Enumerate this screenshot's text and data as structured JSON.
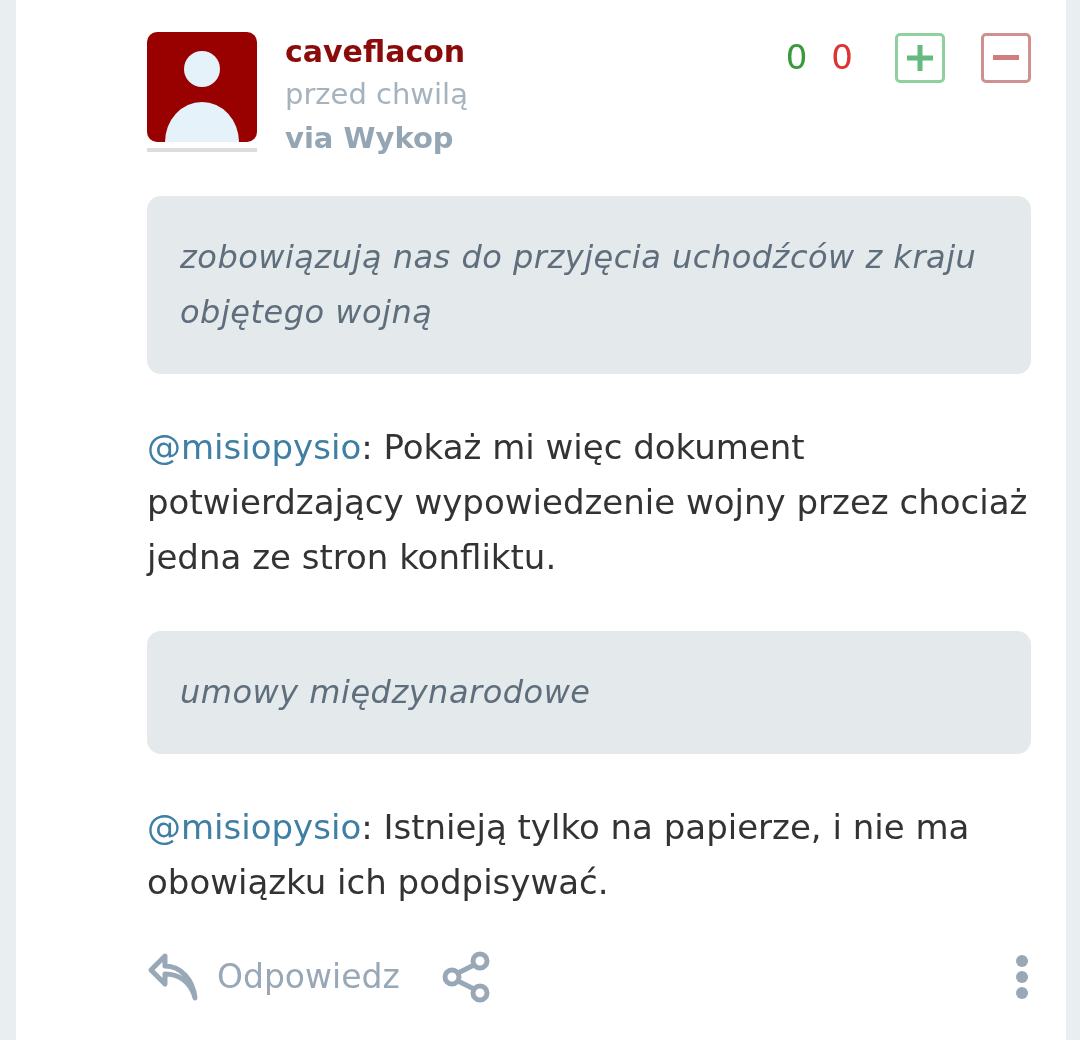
{
  "author": {
    "name": "caveflacon",
    "time": "przed chwilą",
    "source": "via Wykop"
  },
  "votes": {
    "plus_count": "0",
    "minus_count": "0"
  },
  "blocks": [
    {
      "kind": "quote",
      "text": "zobowiązują nas do przyjęcia uchodźców z kraju objętego wojną"
    },
    {
      "kind": "reply",
      "mention": "@misiopysio",
      "text": ": Pokaż mi więc dokument potwierdzający wypowiedzenie wojny przez chociaż jedna ze stron konfliktu."
    },
    {
      "kind": "quote",
      "text": "umowy międzynarodowe"
    },
    {
      "kind": "reply",
      "mention": "@misiopysio",
      "text": ": Istnieją tylko na papierze, i nie ma obowiązku ich podpisywać."
    }
  ],
  "actions": {
    "reply": "Odpowiedz"
  }
}
